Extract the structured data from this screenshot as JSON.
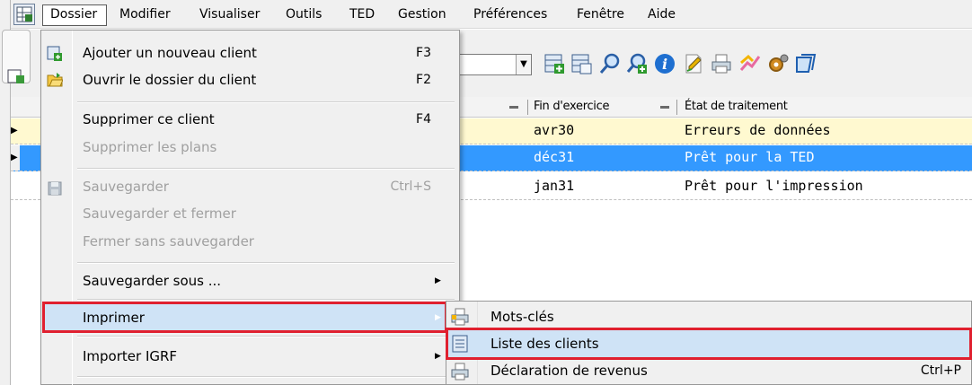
{
  "menubar": {
    "items": [
      "Dossier",
      "Modifier",
      "Visualiser",
      "Outils",
      "TED",
      "Gestion",
      "Préférences",
      "Fenêtre",
      "Aide"
    ]
  },
  "grid": {
    "headers": [
      "Fin d'exercice",
      "État de traitement"
    ],
    "rows": [
      {
        "fin": "avr30",
        "etat": "Erreurs de données",
        "state": "warning"
      },
      {
        "fin": "déc31",
        "etat": "Prêt pour la TED",
        "state": "selected"
      },
      {
        "fin": "jan31",
        "etat": "Prêt pour l'impression",
        "state": "normal"
      }
    ]
  },
  "dropdown": {
    "items": [
      {
        "label": "Ajouter un nouveau client",
        "shortcut": "F3",
        "enabled": true,
        "icon": "add-client-icon"
      },
      {
        "label": "Ouvrir le dossier du client",
        "shortcut": "F2",
        "enabled": true,
        "icon": "open-folder-icon"
      },
      {
        "label": "Supprimer ce client",
        "shortcut": "F4",
        "enabled": true
      },
      {
        "label": "Supprimer les plans",
        "shortcut": "",
        "enabled": false
      },
      {
        "label": "Sauvegarder",
        "shortcut": "Ctrl+S",
        "enabled": false,
        "icon": "save-icon"
      },
      {
        "label": "Sauvegarder et fermer",
        "shortcut": "",
        "enabled": false
      },
      {
        "label": "Fermer sans sauvegarder",
        "shortcut": "",
        "enabled": false
      },
      {
        "label": "Sauvegarder sous ...",
        "shortcut": "",
        "enabled": true,
        "submenu": true
      },
      {
        "label": "Imprimer",
        "shortcut": "",
        "enabled": true,
        "submenu": true,
        "highlighted": true
      },
      {
        "label": "Importer IGRF",
        "shortcut": "",
        "enabled": true,
        "submenu": true
      }
    ]
  },
  "submenu": {
    "items": [
      {
        "label": "Mots-clés",
        "shortcut": "",
        "icon": "printer-icon"
      },
      {
        "label": "Liste des clients",
        "shortcut": "",
        "icon": "client-list-icon",
        "highlighted": true
      },
      {
        "label": "Déclaration de revenus",
        "shortcut": "Ctrl+P",
        "icon": "printer-icon"
      }
    ]
  },
  "colors": {
    "highlight": "#cfe3f6",
    "annotation_red": "#e0202f",
    "selected_row": "#3399ff",
    "warning_row": "#fff9d0"
  }
}
